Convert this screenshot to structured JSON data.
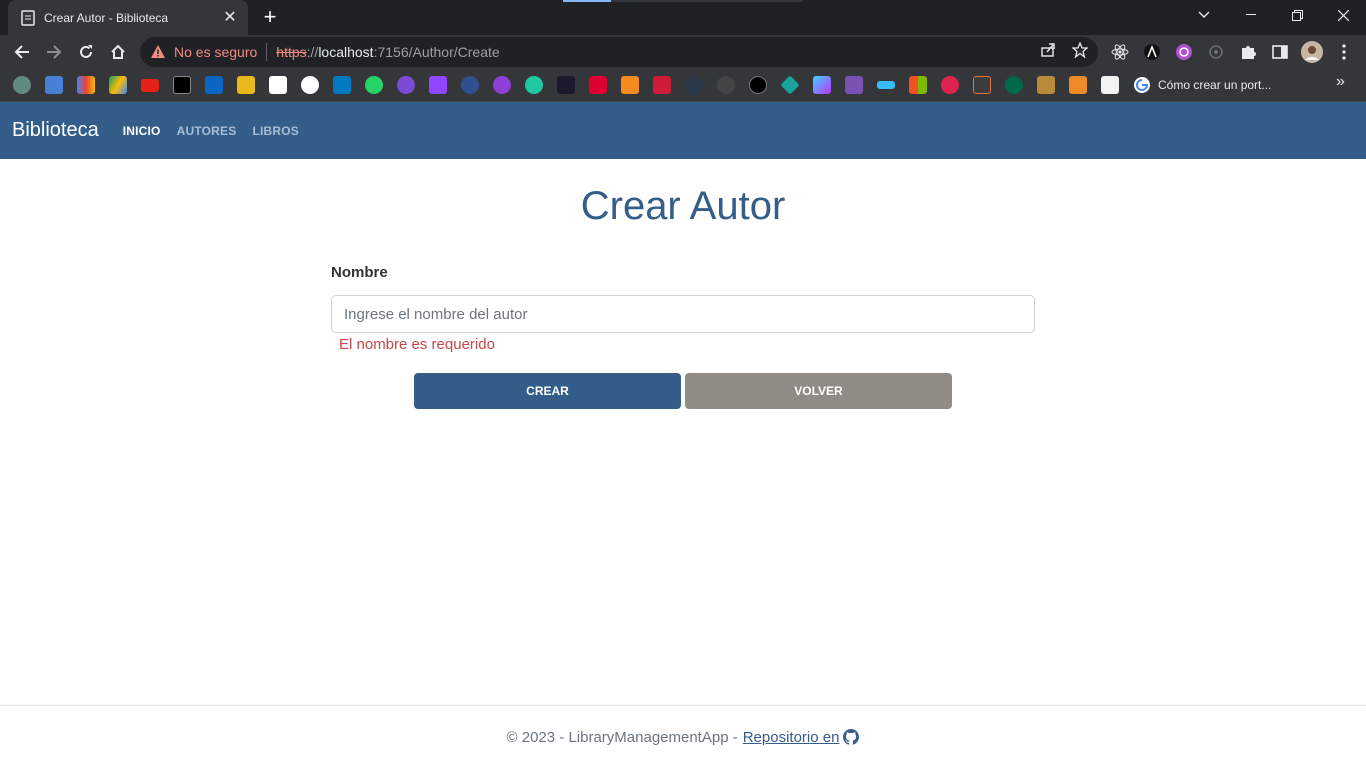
{
  "browser": {
    "tab": {
      "title": "Crear Autor - Biblioteca"
    },
    "omnibox": {
      "security_label": "No es seguro",
      "url_scheme": "https",
      "url_sep": "://",
      "url_host": "localhost",
      "url_rest": ":7156/Author/Create"
    },
    "bookmarks": {
      "last_label": "Cómo crear un port...",
      "icons": [
        "chatgpt-icon",
        "google-translate-icon",
        "gmail-icon",
        "google-drive-icon",
        "youtube-icon",
        "x-icon",
        "linkedin-icon",
        "stackoverflow-icon",
        "notion-icon",
        "github-icon",
        "trello-icon",
        "whatsapp-icon",
        "notification-app-icon",
        "twitch-icon",
        "app-c-icon",
        "app-u-icon",
        "app-bubbles-icon",
        "app-lambda-icon",
        "angular-icon",
        "brave-icon",
        "brave-red-icon",
        "react-icon",
        "dot-icon",
        "nextjs-icon",
        "diamond-icon",
        "vite-icon",
        "bootstrap-icon",
        "tailwind-icon",
        "microsoft-icon",
        "nestjs-icon",
        "brackets-icon",
        "mongodb-icon",
        "app-mountain-icon",
        "app-orange-icon",
        "app-white-icon"
      ]
    }
  },
  "navbar": {
    "brand": "Biblioteca",
    "links": [
      "INICIO",
      "AUTORES",
      "LIBROS"
    ]
  },
  "main": {
    "title": "Crear Autor",
    "form": {
      "name_label": "Nombre",
      "name_placeholder": "Ingrese el nombre del autor",
      "name_value": "",
      "error": "El nombre es requerido"
    },
    "buttons": {
      "create": "CREAR",
      "back": "VOLVER"
    }
  },
  "footer": {
    "text": "© 2023 - LibraryManagementApp -",
    "link": "Repositorio en"
  },
  "colors": {
    "primary": "#345d8a",
    "secondary": "#8e8c84",
    "danger": "#c9464a"
  }
}
